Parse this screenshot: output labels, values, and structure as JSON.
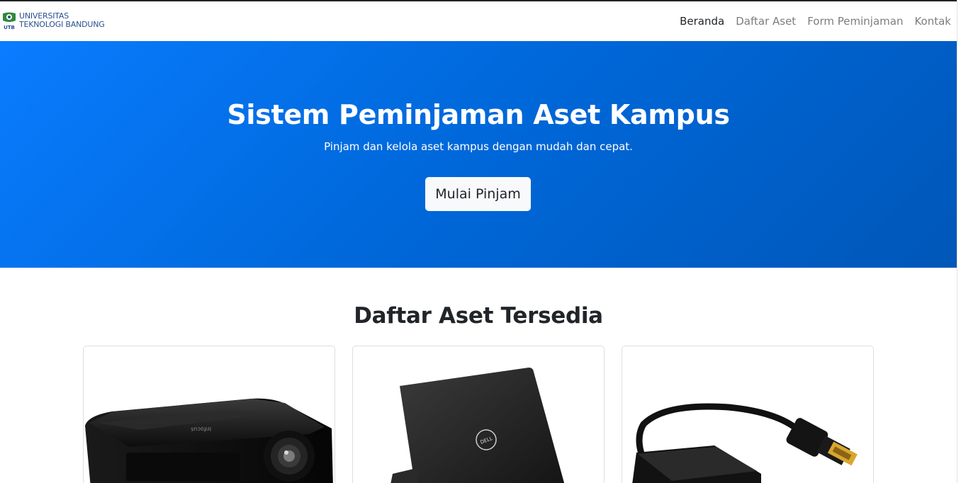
{
  "brand": {
    "emblem_label": "UTB",
    "line1": "UNIVERSITAS",
    "line2": "TEKNOLOGI BANDUNG"
  },
  "nav": {
    "items": [
      {
        "label": "Beranda",
        "active": true
      },
      {
        "label": "Daftar Aset",
        "active": false
      },
      {
        "label": "Form Peminjaman",
        "active": false
      },
      {
        "label": "Kontak",
        "active": false
      }
    ]
  },
  "hero": {
    "title": "Sistem Peminjaman Aset Kampus",
    "subtitle": "Pinjam dan kelola aset kampus dengan mudah dan cepat.",
    "cta_label": "Mulai Pinjam"
  },
  "assets": {
    "title": "Daftar Aset Tersedia",
    "cards": [
      {
        "image": "projector-image",
        "logo_text": "Infocus"
      },
      {
        "image": "laptop-image",
        "logo_text": "DELL"
      },
      {
        "image": "hdmi-adapter-image",
        "logo_text": ""
      }
    ]
  },
  "colors": {
    "hero_start": "#0a7cff",
    "hero_end": "#0057b8",
    "brand_text": "#2a4f8f",
    "nav_inactive": "#7d7d7d"
  }
}
